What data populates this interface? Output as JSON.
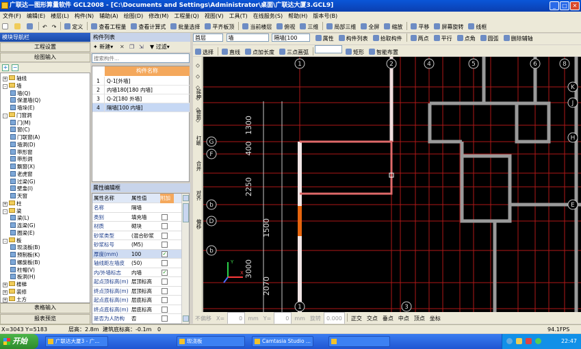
{
  "title": "广联达—图形算量软件 GCL2008 - [C:\\Documents and Settings\\Administrator\\桌面\\广联达大厦3.GCL9]",
  "menu": [
    "文件(F)",
    "编辑(E)",
    "楼层(L)",
    "构件(N)",
    "辅助(A)",
    "绘图(D)",
    "修改(M)",
    "工程量(Q)",
    "视图(V)",
    "工具(T)",
    "在线服务(S)",
    "帮助(H)",
    "版本号(B)"
  ],
  "toolbar1": [
    "定义",
    "查看工程量",
    "查看计算式",
    "批量选择",
    "平齐板顶",
    "当前楼层",
    "俯视",
    "三维",
    "局部三维",
    "全屏",
    "缩放",
    "平移",
    "屏幕旋转",
    "线框"
  ],
  "nav": {
    "header": "模块导航栏",
    "btn_project": "工程设置",
    "btn_draw": "绘图输入",
    "btn_table": "表格输入",
    "btn_report": "报表预览",
    "tree": [
      {
        "label": "轴线",
        "type": "folder",
        "level": 0,
        "exp": "+"
      },
      {
        "label": "墙",
        "type": "folder",
        "level": 0,
        "exp": "-"
      },
      {
        "label": "墙(Q)",
        "type": "item",
        "level": 1
      },
      {
        "label": "保温墙(Q)",
        "type": "item",
        "level": 1
      },
      {
        "label": "墙垛(E)",
        "type": "item",
        "level": 1
      },
      {
        "label": "门窗洞",
        "type": "folder",
        "level": 0,
        "exp": "-"
      },
      {
        "label": "门(M)",
        "type": "item",
        "level": 1
      },
      {
        "label": "窗(C)",
        "type": "item",
        "level": 1
      },
      {
        "label": "门联窗(A)",
        "type": "item",
        "level": 1
      },
      {
        "label": "墙洞(D)",
        "type": "item",
        "level": 1
      },
      {
        "label": "带形窗",
        "type": "item",
        "level": 1
      },
      {
        "label": "带形洞",
        "type": "item",
        "level": 1
      },
      {
        "label": "飘窗(X)",
        "type": "item",
        "level": 1
      },
      {
        "label": "老虎窗",
        "type": "item",
        "level": 1
      },
      {
        "label": "过梁(G)",
        "type": "item",
        "level": 1
      },
      {
        "label": "壁龛(I)",
        "type": "item",
        "level": 1
      },
      {
        "label": "天窗",
        "type": "item",
        "level": 1
      },
      {
        "label": "柱",
        "type": "folder",
        "level": 0,
        "exp": "+"
      },
      {
        "label": "梁",
        "type": "folder",
        "level": 0,
        "exp": "-"
      },
      {
        "label": "梁(L)",
        "type": "item",
        "level": 1
      },
      {
        "label": "连梁(G)",
        "type": "item",
        "level": 1
      },
      {
        "label": "圈梁(E)",
        "type": "item",
        "level": 1
      },
      {
        "label": "板",
        "type": "folder",
        "level": 0,
        "exp": "-"
      },
      {
        "label": "现浇板(B)",
        "type": "item",
        "level": 1
      },
      {
        "label": "预制板(K)",
        "type": "item",
        "level": 1
      },
      {
        "label": "螺旋板(B)",
        "type": "item",
        "level": 1
      },
      {
        "label": "柱帽(V)",
        "type": "item",
        "level": 1
      },
      {
        "label": "板洞(H)",
        "type": "item",
        "level": 1
      },
      {
        "label": "楼梯",
        "type": "folder",
        "level": 0,
        "exp": "+"
      },
      {
        "label": "装修",
        "type": "folder",
        "level": 0,
        "exp": "+"
      },
      {
        "label": "土方",
        "type": "folder",
        "level": 0,
        "exp": "+"
      }
    ]
  },
  "component_list": {
    "header": "构件列表",
    "new_btn": "新建",
    "filter_btn": "过滤",
    "search_placeholder": "搜索构件...",
    "col_name": "构件名称",
    "rows": [
      {
        "n": "1",
        "name": "Q-1[外墙]"
      },
      {
        "n": "2",
        "name": "内墙180[180 内墙]"
      },
      {
        "n": "3",
        "name": "Q-2[180 外墙]"
      },
      {
        "n": "4",
        "name": "隔墙[100 内墙]"
      }
    ]
  },
  "properties": {
    "header": "属性编辑框",
    "col_name": "属性名称",
    "col_value": "属性值",
    "col_extra": "附加",
    "rows": [
      {
        "k": "名称",
        "v": "隔墙",
        "c": false,
        "hasc": false
      },
      {
        "k": "类别",
        "v": "填充墙",
        "c": false,
        "hasc": true
      },
      {
        "k": "材质",
        "v": "砌块",
        "c": false,
        "hasc": true
      },
      {
        "k": "砂浆类型",
        "v": "(混合砂浆",
        "c": false,
        "hasc": true
      },
      {
        "k": "砂浆标号",
        "v": "(M5)",
        "c": false,
        "hasc": true
      },
      {
        "k": "厚度(mm)",
        "v": "100",
        "c": true,
        "hasc": true
      },
      {
        "k": "轴线距左墙皮",
        "v": "(50)",
        "c": false,
        "hasc": true
      },
      {
        "k": "内/外墙标志",
        "v": "内墙",
        "c": true,
        "hasc": true
      },
      {
        "k": "起点顶标高(m)",
        "v": "层顶标高",
        "c": false,
        "hasc": true
      },
      {
        "k": "终点顶标高(m)",
        "v": "层顶标高",
        "c": false,
        "hasc": true
      },
      {
        "k": "起点底标高(m)",
        "v": "层底标高",
        "c": false,
        "hasc": true
      },
      {
        "k": "终点底标高(m)",
        "v": "层底标高",
        "c": false,
        "hasc": true
      },
      {
        "k": "是否为人防构",
        "v": "否",
        "c": false,
        "hasc": true
      }
    ]
  },
  "vtools": [
    "延伸",
    "修剪",
    "打断",
    "合并",
    "对齐",
    "偏移"
  ],
  "toolbar2": {
    "floor": "首层",
    "type": "墙",
    "comp": "隔墙[100",
    "btns": [
      "属性",
      "构件列表",
      "拾取构件",
      "两点",
      "平行",
      "点角",
      "圆弧",
      "删除辅轴"
    ]
  },
  "toolbar3": [
    "选择",
    "直线",
    "点加长度",
    "三点画弧",
    "矩形",
    "智能布置"
  ],
  "snap": [
    "不偏移",
    "X=",
    "0",
    "mm",
    "Y=",
    "0",
    "mm",
    "旋转",
    "0.000",
    "正交",
    "交点",
    "垂点",
    "中点",
    "顶点",
    "坐标"
  ],
  "status": {
    "coords": "X=3043 Y=5183",
    "floor_height": "层高：2.8m",
    "elevation": "建筑底标高：-0.1m",
    "zero": "0",
    "fps": "94.1FPS"
  },
  "drawing": {
    "axis_labels_top": [
      "1",
      "2",
      "4",
      "5",
      "6",
      "8"
    ],
    "axis_labels_side": [
      "K",
      "J",
      "G",
      "F",
      "H",
      "E",
      "b",
      "D",
      "b"
    ],
    "dims": [
      "1300",
      "400",
      "2250",
      "1500",
      "3000",
      "2070"
    ],
    "bottom_labels": [
      "1",
      "3"
    ]
  },
  "taskbar": {
    "start": "开始",
    "tasks": [
      "广联达大厦3 - 广...",
      "现浇板",
      "Camtasia Studio ...",
      ""
    ],
    "clock": "22:47"
  }
}
